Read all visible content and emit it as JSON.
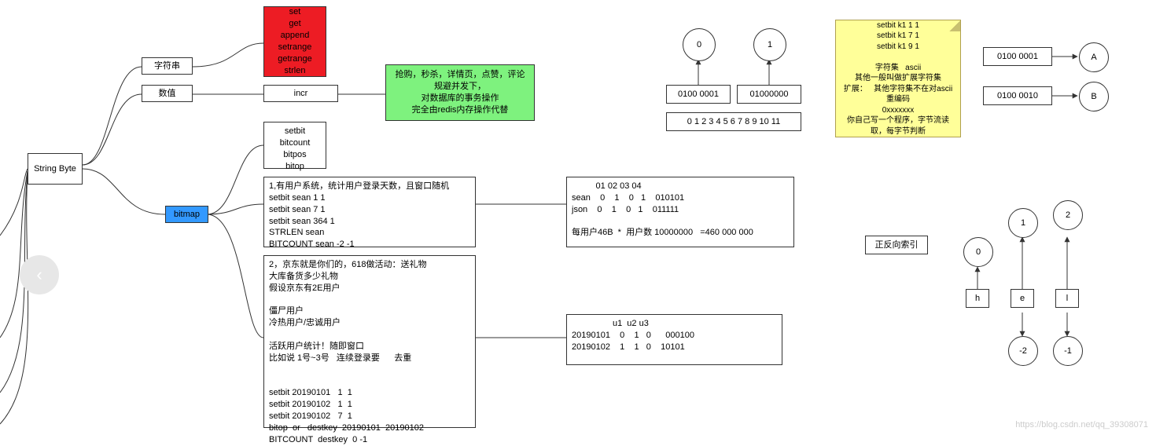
{
  "root": {
    "title": "String\nByte"
  },
  "level1": {
    "str": "字符串",
    "num": "数值",
    "bitmap": "bitmap"
  },
  "red_ops": "set\nget\nappend\nsetrange\ngetrange\nstrlen",
  "incr": "incr",
  "green_note": "抢购，秒杀，详情页，点赞，评论\n规避并发下，\n对数据库的事务操作\n完全由redis内存操作代替",
  "bit_ops": "setbit\nbitcount\nbitpos\nbitop",
  "bitmap_ex1": "1,有用户系统，统计用户登录天数，且窗口随机\nsetbit sean 1 1\nsetbit sean 7 1\nsetbit sean 364 1\nSTRLEN sean\nBITCOUNT sean -2 -1",
  "bitmap_ex1_out": "          01 02 03 04\nsean    0    1    0   1    010101\njson    0    1    0   1    011111\n\n每用户46B  *  用户数 10000000   =460 000 000",
  "bitmap_ex2": "2，京东就是你们的，618做活动：送礼物\n大库备货多少礼物\n假设京东有2E用户\n\n僵尸用户\n冷热用户/忠诚用户\n\n活跃用户统计！随即窗口\n比如说 1号~3号   连续登录要      去重\n\n\nsetbit 20190101   1  1\nsetbit 20190102   1  1\nsetbit 20190102   7  1\nbitop  or   destkey  20190101  20190102\nBITCOUNT  destkey  0 -1",
  "bitmap_ex2_out": "                 u1  u2 u3\n20190101    0    1   0      000100\n20190102    1    1   0    10101",
  "ascii_demo": {
    "c0": "0",
    "c1": "1",
    "byte0": "0100  0001",
    "byte1": "01000000",
    "idx": "0 1 2 3 4 5 6 7          8 9 10 11"
  },
  "note_box": "setbit k1 1 1\nsetbit k1 7 1\nsetbit k1 9 1\n\n字符集   ascii\n其他一般叫做扩展字符集\n扩展：   其他字符集不在对ascii\n重编码\n0xxxxxxx\n你自己写一个程序，字节流读\n取，每字节判断",
  "map_a": {
    "bits": "0100  0001",
    "ch": "A"
  },
  "map_b": {
    "bits": "0100  0010",
    "ch": "B"
  },
  "index_title": "正反向索引",
  "idx_ring": {
    "n0": "0",
    "n1": "1",
    "n2": "2",
    "h": "h",
    "e": "e",
    "l": "l",
    "m2": "-2",
    "m1": "-1"
  },
  "watermark": "https://blog.csdn.net/qq_39308071",
  "back": "‹"
}
